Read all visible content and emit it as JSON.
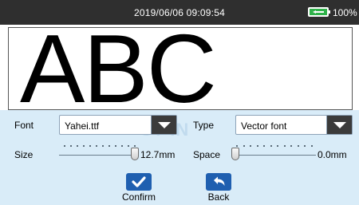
{
  "status_bar": {
    "datetime": "2019/06/06 09:09:54",
    "battery_percent": "100%",
    "battery_icon": "battery-charging-icon",
    "battery_level": 1.0
  },
  "preview": {
    "text": "ABC"
  },
  "font": {
    "label": "Font",
    "value": "Yahei.ttf"
  },
  "type": {
    "label": "Type",
    "value": "Vector font"
  },
  "size": {
    "label": "Size",
    "value": "12.7mm",
    "level": 1.0
  },
  "space": {
    "label": "Space",
    "value": "0.0mm",
    "level": 0.0
  },
  "actions": {
    "confirm_label": "Confirm",
    "back_label": "Back"
  },
  "watermark": "ST IN",
  "colors": {
    "status_bar": "#2f2f2f",
    "panel": "#d9ecf8",
    "action_button": "#1f5fb0",
    "battery_fill": "#2fb24a"
  }
}
